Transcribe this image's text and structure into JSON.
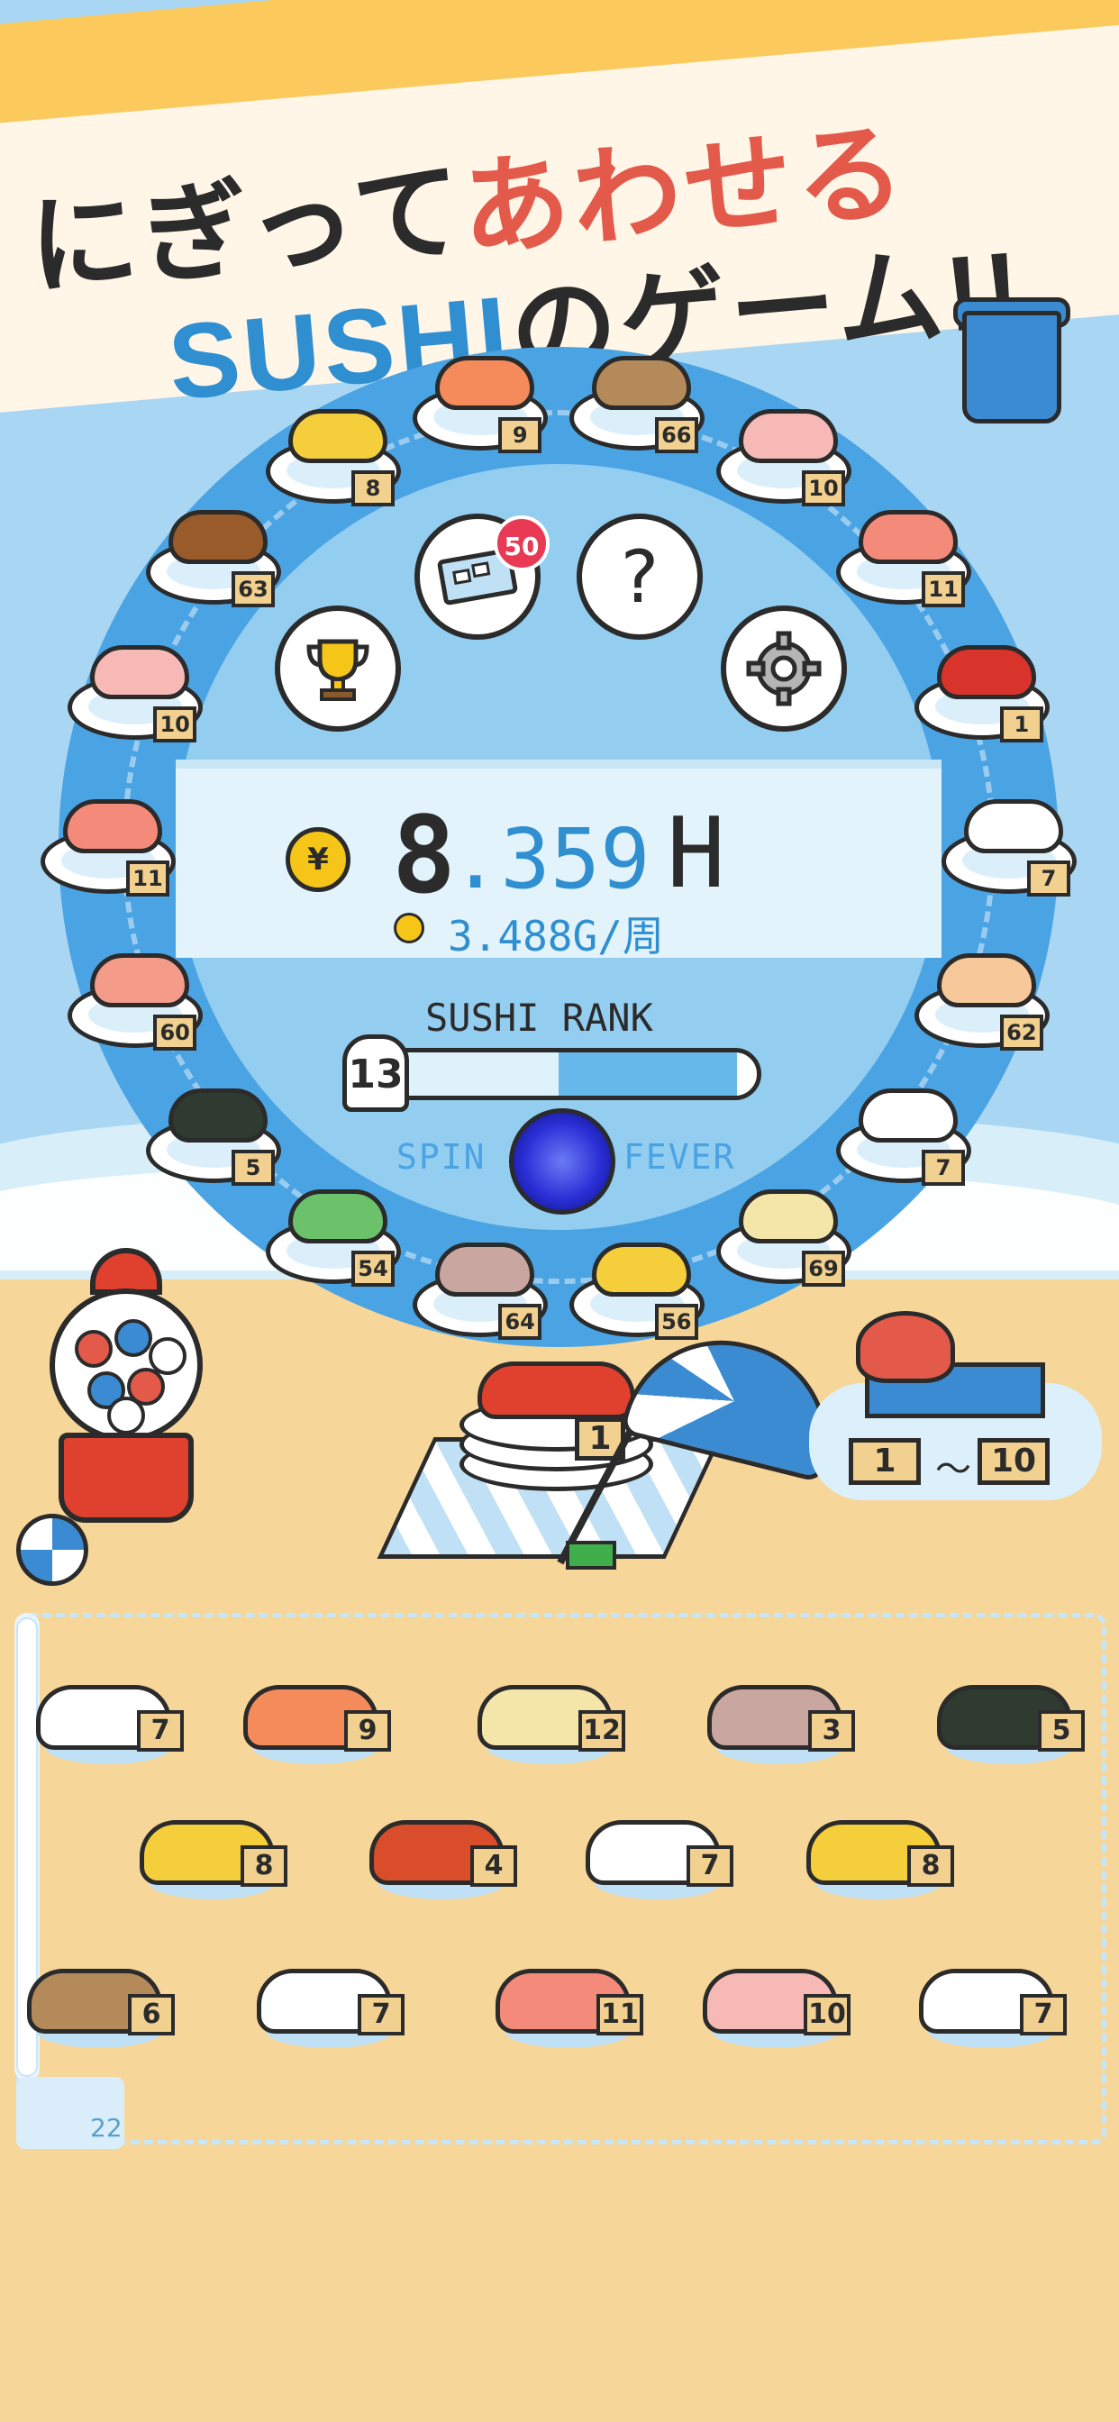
{
  "banner": {
    "line1_a": "にぎって",
    "line1_b": "あわせる",
    "line2_a": "SUSHI",
    "line2_b": "のゲーム!!"
  },
  "colors": {
    "sea": "#a9d6f2",
    "sand": "#f7d69a",
    "ring": "#4aa3e3",
    "accent_red": "#e35a4b",
    "accent_blue": "#2f8fd0",
    "banner_yellow": "#fbc95c"
  },
  "ring": {
    "plates": [
      {
        "level": "9",
        "kind": "shrimp"
      },
      {
        "level": "66",
        "kind": "eel"
      },
      {
        "level": "10",
        "kind": "sea-bream"
      },
      {
        "level": "11",
        "kind": "salmon"
      },
      {
        "level": "1",
        "kind": "tuna"
      },
      {
        "level": "7",
        "kind": "squid"
      },
      {
        "level": "62",
        "kind": "scallop"
      },
      {
        "level": "7",
        "kind": "squid"
      },
      {
        "level": "69",
        "kind": "yellowtail"
      },
      {
        "level": "56",
        "kind": "tamago"
      },
      {
        "level": "64",
        "kind": "mackerel"
      },
      {
        "level": "54",
        "kind": "cucumber-roll"
      },
      {
        "level": "5",
        "kind": "tuna-roll"
      },
      {
        "level": "60",
        "kind": "salmon-special"
      },
      {
        "level": "11",
        "kind": "salmon"
      },
      {
        "level": "10",
        "kind": "sea-bream"
      },
      {
        "level": "63",
        "kind": "katsu"
      },
      {
        "level": "8",
        "kind": "tamago"
      }
    ]
  },
  "menu": {
    "ticket_badge": "50",
    "trophy_icon": "trophy-icon",
    "ticket_icon": "ticket-icon",
    "help_icon": "help-icon",
    "settings_icon": "gear-icon",
    "help_glyph": "?"
  },
  "money": {
    "coin_symbol": "¥",
    "amount_int": "8",
    "amount_dec": ".359",
    "unit": "H",
    "rate": "3.488G/周"
  },
  "rank": {
    "label": "SUSHI RANK",
    "level": "13",
    "progress": 0.5
  },
  "fever": {
    "left": "SPIN",
    "right": "FEVER"
  },
  "table": {
    "stack_level": "1"
  },
  "octopus": {
    "range_min": "1",
    "range_sep": "〜",
    "range_max": "10"
  },
  "board": {
    "count": "22",
    "rows": [
      [
        {
          "level": "7",
          "kind": "squid"
        },
        {
          "level": "9",
          "kind": "shrimp"
        },
        {
          "level": "12",
          "kind": "yellowtail"
        },
        {
          "level": "3",
          "kind": "mackerel"
        },
        {
          "level": "5",
          "kind": "tuna-roll"
        }
      ],
      [
        {
          "level": "8",
          "kind": "tamago"
        },
        {
          "level": "4",
          "kind": "ikura"
        },
        {
          "level": "7",
          "kind": "squid"
        },
        {
          "level": "8",
          "kind": "tamago"
        }
      ],
      [
        {
          "level": "6",
          "kind": "eel"
        },
        {
          "level": "7",
          "kind": "squid"
        },
        {
          "level": "11",
          "kind": "salmon"
        },
        {
          "level": "10",
          "kind": "sea-bream"
        },
        {
          "level": "7",
          "kind": "squid"
        }
      ]
    ]
  }
}
